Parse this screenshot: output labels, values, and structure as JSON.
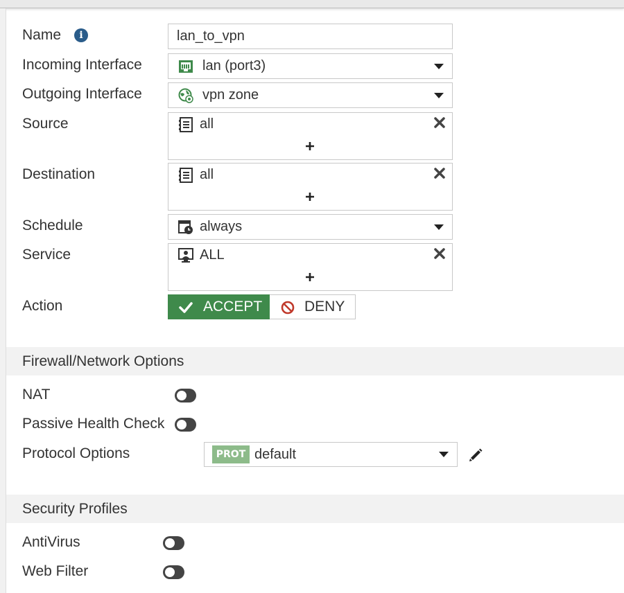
{
  "colors": {
    "accept_green": "#3f8a4b",
    "deny_red": "#c0392b",
    "info_blue": "#2a5c8a",
    "prot_badge": "#8dbb8a",
    "toggle_off": "#444444",
    "section_bg": "#f2f2f2"
  },
  "form": {
    "name": {
      "label": "Name",
      "value": "lan_to_vpn",
      "icon": "info-icon"
    },
    "incoming": {
      "label": "Incoming Interface",
      "value": "lan (port3)",
      "icon": "port-icon"
    },
    "outgoing": {
      "label": "Outgoing Interface",
      "value": "vpn zone",
      "icon": "zone-globe-icon"
    },
    "source": {
      "label": "Source",
      "entry": "all",
      "icon": "address-icon"
    },
    "destination": {
      "label": "Destination",
      "entry": "all",
      "icon": "address-icon"
    },
    "schedule": {
      "label": "Schedule",
      "value": "always",
      "icon": "schedule-icon"
    },
    "service": {
      "label": "Service",
      "entry": "ALL",
      "icon": "service-icon"
    },
    "action": {
      "label": "Action",
      "accept": "ACCEPT",
      "deny": "DENY",
      "selected": "ACCEPT"
    }
  },
  "firewall_section": {
    "title": "Firewall/Network Options",
    "nat": {
      "label": "NAT",
      "enabled": false
    },
    "health": {
      "label": "Passive Health Check",
      "enabled": false
    },
    "protocol": {
      "label": "Protocol Options",
      "badge": "PROT",
      "value": "default"
    }
  },
  "security_section": {
    "title": "Security Profiles",
    "antivirus": {
      "label": "AntiVirus",
      "enabled": false
    },
    "webfilter": {
      "label": "Web Filter",
      "enabled": false
    }
  }
}
